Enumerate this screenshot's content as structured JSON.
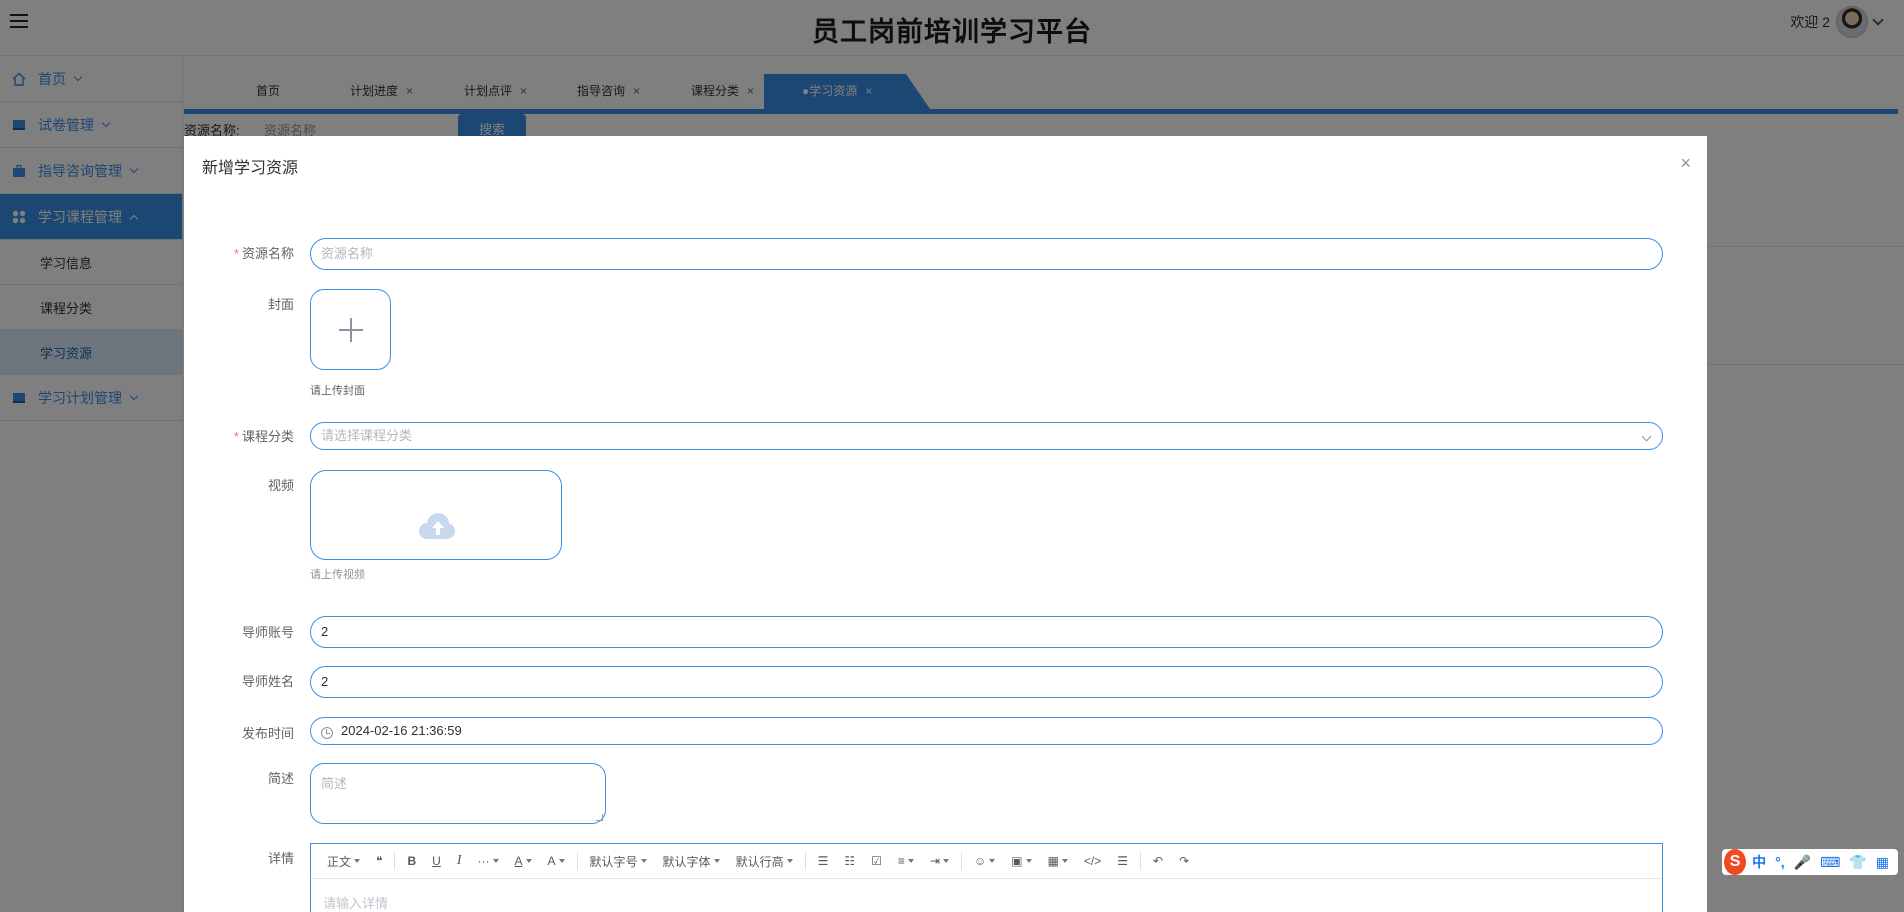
{
  "header": {
    "app_title": "员工岗前培训学习平台",
    "welcome_text": "欢迎 2"
  },
  "sidebar": {
    "items": [
      {
        "label": "首页",
        "icon": "home-icon"
      },
      {
        "label": "试卷管理",
        "icon": "book-icon"
      },
      {
        "label": "指导咨询管理",
        "icon": "briefcase-icon"
      },
      {
        "label": "学习课程管理",
        "icon": "grid-icon",
        "expanded": true,
        "children": [
          {
            "label": "学习信息"
          },
          {
            "label": "课程分类"
          },
          {
            "label": "学习资源",
            "current": true
          }
        ]
      },
      {
        "label": "学习计划管理",
        "icon": "book-icon"
      }
    ]
  },
  "tabs": [
    {
      "label": "首页",
      "closable": false
    },
    {
      "label": "计划进度",
      "closable": true
    },
    {
      "label": "计划点评",
      "closable": true
    },
    {
      "label": "指导咨询",
      "closable": true
    },
    {
      "label": "课程分类",
      "closable": true
    },
    {
      "label": "●学习资源",
      "closable": true,
      "active": true
    }
  ],
  "search": {
    "label": "资源名称:",
    "placeholder": "资源名称",
    "button_label": "搜索"
  },
  "dialog": {
    "title": "新增学习资源",
    "close_symbol": "×",
    "fields": {
      "resource_name": {
        "label": "资源名称",
        "required": true,
        "placeholder": "资源名称",
        "value": ""
      },
      "cover": {
        "label": "封面",
        "hint": "请上传封面"
      },
      "category": {
        "label": "课程分类",
        "required": true,
        "placeholder": "请选择课程分类"
      },
      "video": {
        "label": "视频",
        "hint": "请上传视频"
      },
      "tutor_account": {
        "label": "导师账号",
        "value": "2"
      },
      "tutor_name": {
        "label": "导师姓名",
        "value": "2"
      },
      "publish_time": {
        "label": "发布时间",
        "value": "2024-02-16 21:36:59"
      },
      "summary": {
        "label": "简述",
        "placeholder": "简述"
      },
      "detail": {
        "label": "详情",
        "placeholder": "请输入详情"
      }
    },
    "editor_toolbar": {
      "paragraph": "正文",
      "quote": "❝",
      "bold": "B",
      "underline": "U",
      "italic": "I",
      "more": "···",
      "font_color": "A",
      "bg_color": "A",
      "font_size": "默认字号",
      "font_family": "默认字体",
      "line_height": "默认行高",
      "bullet_list": "☰",
      "numbered_list": "☷",
      "todo": "☑",
      "align": "≡",
      "indent": "⇥",
      "emoji": "☺",
      "image": "▣",
      "table": "▦",
      "code": "</>",
      "divider": "☰",
      "undo": "↶",
      "redo": "↷"
    }
  },
  "ime": {
    "logo": "S",
    "mode": "中",
    "punct": "°,",
    "mic": "🎤",
    "keyboard": "⌨",
    "skin": "👕",
    "grid": "▦"
  },
  "colors": {
    "accent": "#3a8ee6",
    "overlay": "rgba(0,0,0,0.5)",
    "required": "#f56c6c"
  }
}
